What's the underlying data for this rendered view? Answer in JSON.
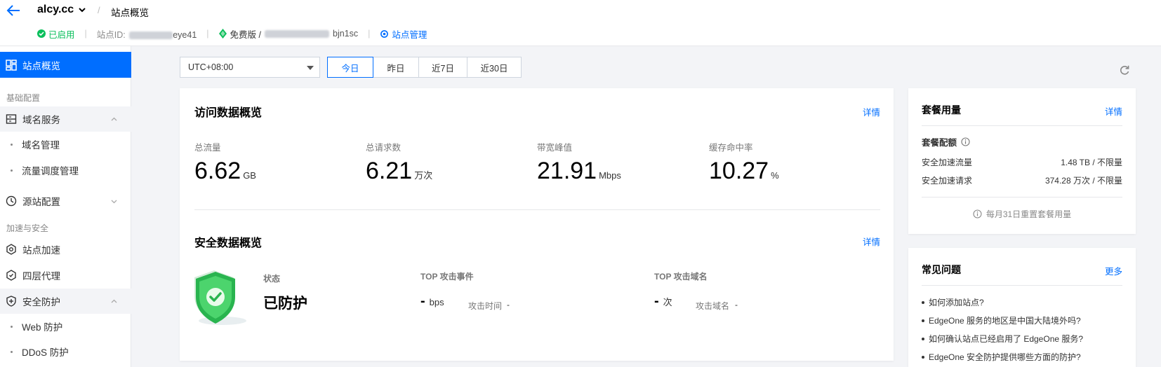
{
  "header": {
    "site_name": "alcy.cc",
    "breadcrumb_sep": "/",
    "page_title": "站点概览",
    "status": "已启用",
    "site_id_label": "站点ID:",
    "site_id_visible": "eye41",
    "plan_label": "免费版 /",
    "plan_id_visible": "bjn1sc",
    "manage_link": "站点管理"
  },
  "sidebar": {
    "active_item": "站点概览",
    "groups": [
      {
        "label": "基础配置"
      },
      {
        "label": "加速与安全"
      }
    ],
    "items": {
      "domain_service": "域名服务",
      "domain_manage": "域名管理",
      "traffic_manage": "流量调度管理",
      "origin_config": "源站配置",
      "site_accel": "站点加速",
      "l4_proxy": "四层代理",
      "security": "安全防护",
      "web_protect": "Web 防护",
      "ddos_protect": "DDoS 防护"
    }
  },
  "filters": {
    "timezone": "UTC+08:00",
    "ranges": [
      "今日",
      "昨日",
      "近7日",
      "近30日"
    ],
    "active_range": "今日"
  },
  "access_overview": {
    "title": "访问数据概览",
    "detail_link": "详情",
    "metrics": [
      {
        "label": "总流量",
        "value": "6.62",
        "unit": "GB"
      },
      {
        "label": "总请求数",
        "value": "6.21",
        "unit": "万次"
      },
      {
        "label": "带宽峰值",
        "value": "21.91",
        "unit": "Mbps"
      },
      {
        "label": "缓存命中率",
        "value": "10.27",
        "unit": "%"
      }
    ]
  },
  "security_overview": {
    "title": "安全数据概览",
    "detail_link": "详情",
    "status_label": "状态",
    "status_value": "已防护",
    "top_event_label": "TOP 攻击事件",
    "top_event_value": "-",
    "top_event_unit": "bps",
    "attack_time_label": "攻击时间",
    "attack_time_value": "-",
    "top_domain_label": "TOP 攻击域名",
    "top_domain_value": "-",
    "top_domain_unit": "次",
    "attack_domain_label": "攻击域名",
    "attack_domain_value": "-"
  },
  "plan_usage": {
    "title": "套餐用量",
    "detail_link": "详情",
    "quota_label": "套餐配额",
    "rows": [
      {
        "label": "安全加速流量",
        "value": "1.48 TB / 不限量"
      },
      {
        "label": "安全加速请求",
        "value": "374.28 万次 / 不限量"
      }
    ],
    "reset_note": "每月31日重置套餐用量"
  },
  "faq": {
    "title": "常见问题",
    "more_link": "更多",
    "items": [
      "如何添加站点?",
      "EdgeOne 服务的地区是中国大陆境外吗?",
      "如何确认站点已经启用了 EdgeOne 服务?",
      "EdgeOne 安全防护提供哪些方面的防护?"
    ]
  },
  "colors": {
    "accent": "#006eff",
    "success": "#0abf5b",
    "page_bg": "#f3f4f7"
  },
  "icons": [
    "back-arrow-icon",
    "chevron-down-icon",
    "check-circle-icon",
    "plan-icon",
    "gear-icon",
    "dashboard-icon",
    "domain-icon",
    "origin-icon",
    "accel-icon",
    "proxy-icon",
    "shield-icon",
    "refresh-icon",
    "info-icon"
  ]
}
